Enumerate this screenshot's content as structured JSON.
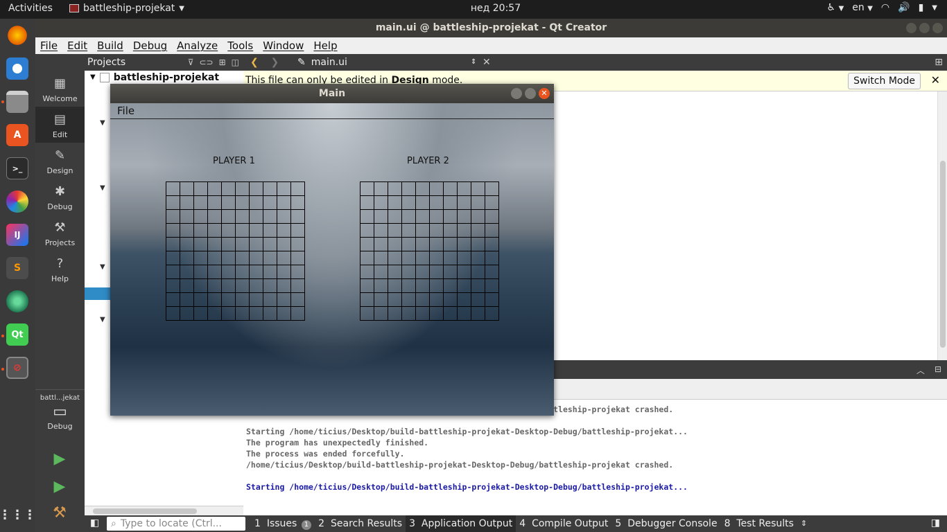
{
  "topbar": {
    "activities": "Activities",
    "app_name": "battleship-projekat",
    "clock": "нед 20:57",
    "language": "en"
  },
  "dock": {
    "icons": [
      "firefox-icon",
      "thunderbird-icon",
      "files-icon",
      "software-center-icon",
      "terminal-icon",
      "color-picker-icon",
      "intellij-icon",
      "sublime-icon",
      "atom-icon",
      "qt-creator-icon",
      "battleship-app-icon",
      "show-apps-icon"
    ]
  },
  "qt": {
    "title": "main.ui @ battleship-projekat - Qt Creator",
    "menu": [
      "File",
      "Edit",
      "Build",
      "Debug",
      "Analyze",
      "Tools",
      "Window",
      "Help"
    ],
    "modes": [
      {
        "label": "Welcome",
        "icon": "grid-icon"
      },
      {
        "label": "Edit",
        "icon": "document-icon"
      },
      {
        "label": "Design",
        "icon": "pen-icon"
      },
      {
        "label": "Debug",
        "icon": "bug-icon"
      },
      {
        "label": "Projects",
        "icon": "wrench-icon"
      },
      {
        "label": "Help",
        "icon": "question-icon"
      }
    ],
    "kit_label": "battl...jekat",
    "kit_mode": "Debug",
    "projects_header": "Projects",
    "project_root": "battleship-projekat",
    "editor_file": "main.ui",
    "info_prefix": "This file can only be edited in ",
    "info_bold": "Design",
    "info_suffix": " mode.",
    "switch_mode": "Switch Mode",
    "output_lines": [
      {
        "text": "/home/ticius/Desktop/build-battleship-projekat-Desktop-Debug/battleship-projekat crashed.",
        "style": "gray"
      },
      {
        "text": "",
        "style": "gray"
      },
      {
        "text": "Starting /home/ticius/Desktop/build-battleship-projekat-Desktop-Debug/battleship-projekat...",
        "style": "gray"
      },
      {
        "text": "The program has unexpectedly finished.",
        "style": "gray"
      },
      {
        "text": "The process was ended forcefully.",
        "style": "gray"
      },
      {
        "text": "/home/ticius/Desktop/build-battleship-projekat-Desktop-Debug/battleship-projekat crashed.",
        "style": "gray"
      },
      {
        "text": "",
        "style": "gray"
      },
      {
        "text": "Starting /home/ticius/Desktop/build-battleship-projekat-Desktop-Debug/battleship-projekat...",
        "style": "blue"
      }
    ],
    "locator_placeholder": "Type to locate (Ctrl...",
    "output_tabs": [
      {
        "num": "1",
        "label": "Issues",
        "badge": "1"
      },
      {
        "num": "2",
        "label": "Search Results"
      },
      {
        "num": "3",
        "label": "Application Output",
        "active": true
      },
      {
        "num": "4",
        "label": "Compile Output"
      },
      {
        "num": "5",
        "label": "Debugger Console"
      },
      {
        "num": "8",
        "label": "Test Results"
      }
    ]
  },
  "app": {
    "title": "Main",
    "menu_file": "File",
    "player1": "PLAYER 1",
    "player2": "PLAYER 2",
    "grid_rows": 10,
    "grid_cols": 10
  }
}
